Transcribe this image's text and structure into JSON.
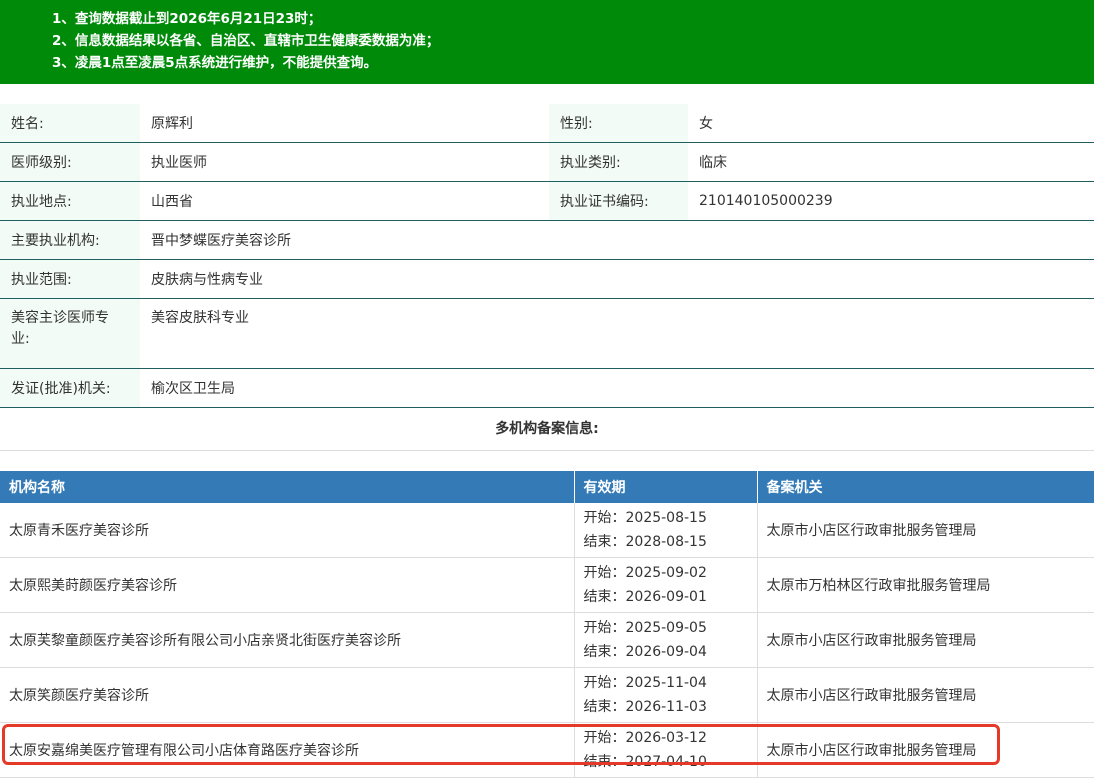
{
  "notice": [
    "1、查询数据截止到2026年6月21日23时；",
    "2、信息数据结果以各省、自治区、直辖市卫生健康委数据为准；",
    "3、凌晨1点至凌晨5点系统进行维护，不能提供查询。"
  ],
  "info": {
    "name_label": "姓名:",
    "name": "原辉利",
    "gender_label": "性别:",
    "gender": "女",
    "level_label": "医师级别:",
    "level": "执业医师",
    "type_label": "执业类别:",
    "type": "临床",
    "location_label": "执业地点:",
    "location": "山西省",
    "cert_label": "执业证书编码:",
    "cert": "210140105000239",
    "main_org_label": "主要执业机构:",
    "main_org": "晋中梦蝶医疗美容诊所",
    "scope_label": "执业范围:",
    "scope": "皮肤病与性病专业",
    "cosmetic_label": "美容主诊医师专业:",
    "cosmetic": "美容皮肤科专业",
    "issuer_label": "发证(批准)机关:",
    "issuer": "榆次区卫生局"
  },
  "multi_title": "多机构备案信息:",
  "org_table": {
    "headers": [
      "机构名称",
      "有效期",
      "备案机关"
    ],
    "rows": [
      {
        "name": "太原青禾医疗美容诊所",
        "start": "开始：2025-08-15",
        "end": "结束：2028-08-15",
        "authority": "太原市小店区行政审批服务管理局"
      },
      {
        "name": "太原熙美莳颜医疗美容诊所",
        "start": "开始：2025-09-02",
        "end": "结束：2026-09-01",
        "authority": "太原市万柏林区行政审批服务管理局"
      },
      {
        "name": "太原芙黎童颜医疗美容诊所有限公司小店亲贤北街医疗美容诊所",
        "start": "开始：2025-09-05",
        "end": "结束：2026-09-04",
        "authority": "太原市小店区行政审批服务管理局"
      },
      {
        "name": "太原笑颜医疗美容诊所",
        "start": "开始：2025-11-04",
        "end": "结束：2026-11-03",
        "authority": "太原市小店区行政审批服务管理局"
      },
      {
        "name": "太原安嘉绵美医疗管理有限公司小店体育路医疗美容诊所",
        "start": "开始：2026-03-12",
        "end": "结束：2027-04-10",
        "authority": "太原市小店区行政审批服务管理局"
      }
    ]
  },
  "colors": {
    "notice_bg": "#008a0a",
    "header_bg": "#337ab7",
    "highlight": "#e53a2a",
    "label_bg": "#f2fbf6"
  }
}
